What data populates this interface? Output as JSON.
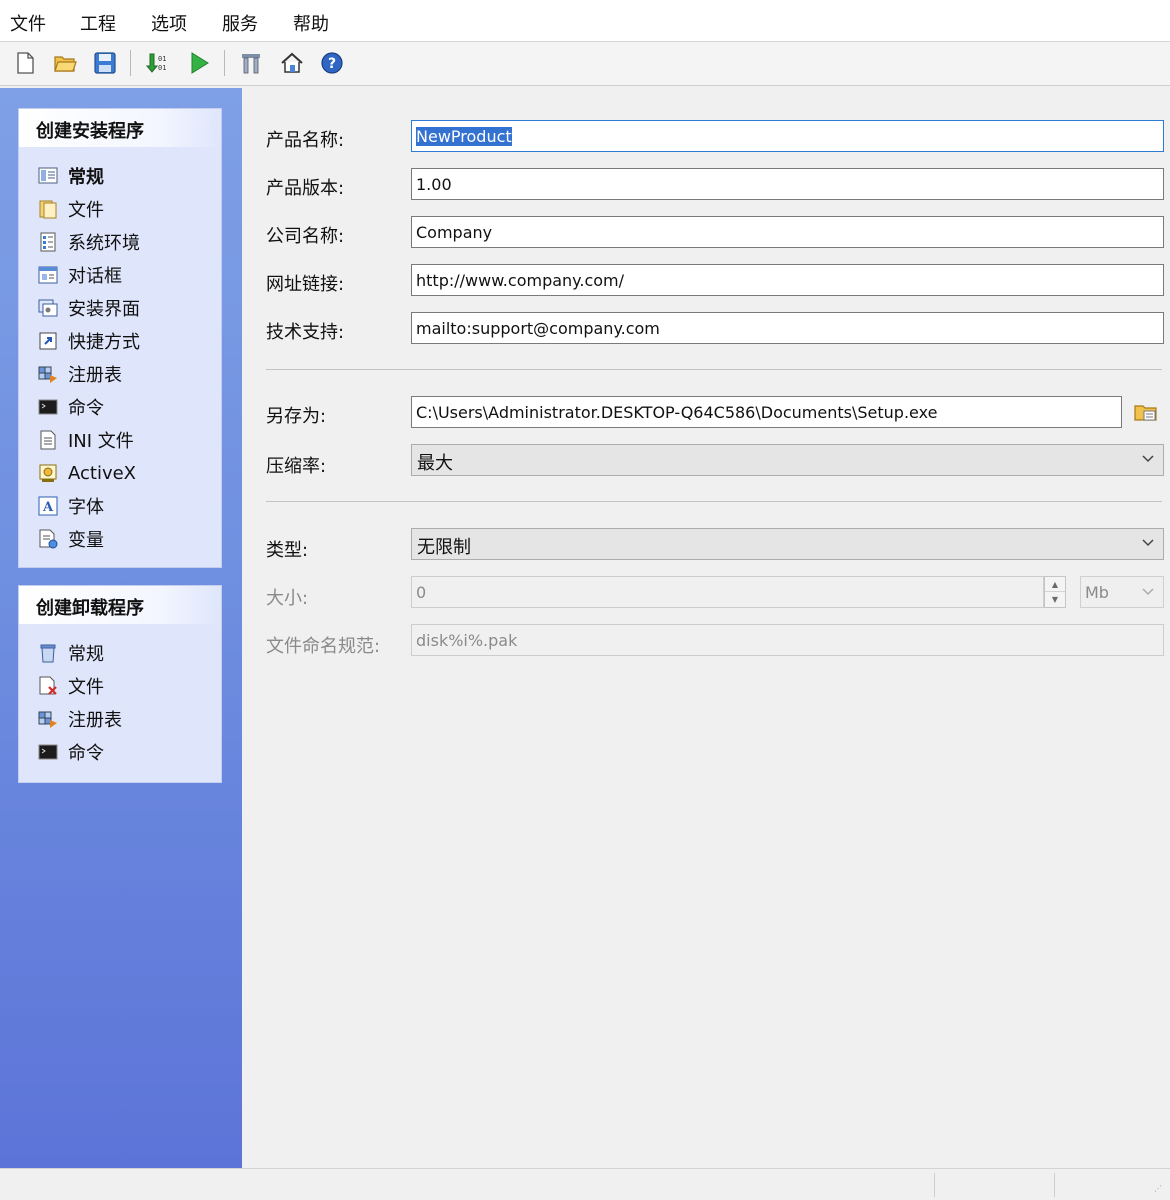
{
  "menu": [
    "文件",
    "工程",
    "选项",
    "服务",
    "帮助"
  ],
  "toolbar": [
    "new-file-icon",
    "open-folder-icon",
    "save-icon",
    "build-icon",
    "run-icon",
    "tools-icon",
    "home-icon",
    "help-icon"
  ],
  "install_panel": {
    "title": "创建安装程序",
    "items": [
      {
        "label": "常规",
        "icon": "general-icon",
        "active": true
      },
      {
        "label": "文件",
        "icon": "files-icon"
      },
      {
        "label": "系统环境",
        "icon": "system-environment-icon"
      },
      {
        "label": "对话框",
        "icon": "dialog-icon"
      },
      {
        "label": "安装界面",
        "icon": "install-interface-icon"
      },
      {
        "label": "快捷方式",
        "icon": "shortcut-icon"
      },
      {
        "label": "注册表",
        "icon": "registry-icon"
      },
      {
        "label": "命令",
        "icon": "command-icon"
      },
      {
        "label": "INI 文件",
        "icon": "ini-file-icon"
      },
      {
        "label": "ActiveX",
        "icon": "activex-icon"
      },
      {
        "label": "字体",
        "icon": "font-icon"
      },
      {
        "label": "变量",
        "icon": "variables-icon"
      }
    ]
  },
  "uninstall_panel": {
    "title": "创建卸载程序",
    "items": [
      {
        "label": "常规",
        "icon": "uninstall-general-icon"
      },
      {
        "label": "文件",
        "icon": "uninstall-files-icon"
      },
      {
        "label": "注册表",
        "icon": "uninstall-registry-icon"
      },
      {
        "label": "命令",
        "icon": "uninstall-command-icon"
      }
    ]
  },
  "form": {
    "product_name": {
      "label": "产品名称:",
      "value": "NewProduct"
    },
    "product_version": {
      "label": "产品版本:",
      "value": "1.00"
    },
    "company_name": {
      "label": "公司名称:",
      "value": "Company"
    },
    "url": {
      "label": "网址链接:",
      "value": "http://www.company.com/"
    },
    "support": {
      "label": "技术支持:",
      "value": "mailto:support@company.com"
    },
    "save_as": {
      "label": "另存为:",
      "value": "C:\\Users\\Administrator.DESKTOP-Q64C586\\Documents\\Setup.exe"
    },
    "compression": {
      "label": "压缩率:",
      "value": "最大"
    },
    "type": {
      "label": "类型:",
      "value": "无限制"
    },
    "size": {
      "label": "大小:",
      "value": "0",
      "unit": "Mb"
    },
    "file_naming": {
      "label": "文件命名规范:",
      "value": "disk%i%.pak"
    }
  },
  "colors": {
    "sidebar_top": "#7fa0e6",
    "sidebar_bottom": "#5c74d8",
    "panel_bg": "#dfe6fb",
    "selection": "#3372d0"
  }
}
